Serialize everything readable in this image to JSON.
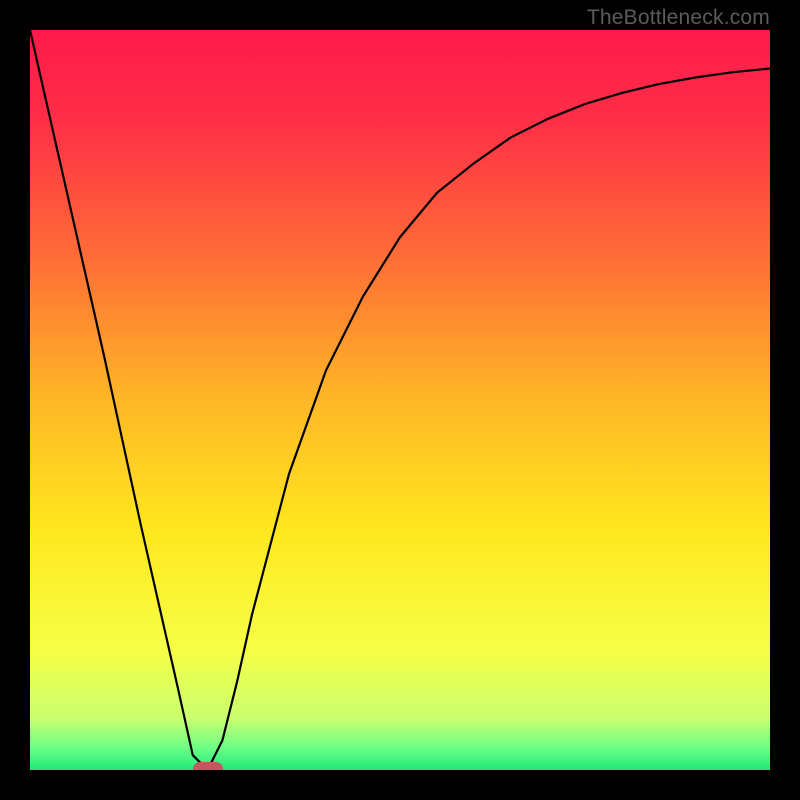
{
  "watermark": "TheBottleneck.com",
  "colors": {
    "background": "#000000",
    "gradient_stops": [
      {
        "pct": 0,
        "color": "#ff1a4b"
      },
      {
        "pct": 12,
        "color": "#ff2e47"
      },
      {
        "pct": 30,
        "color": "#ff6a37"
      },
      {
        "pct": 50,
        "color": "#ffb726"
      },
      {
        "pct": 68,
        "color": "#ffe81f"
      },
      {
        "pct": 84,
        "color": "#f6ff47"
      },
      {
        "pct": 93,
        "color": "#c9ff6e"
      },
      {
        "pct": 97,
        "color": "#6dff86"
      },
      {
        "pct": 100,
        "color": "#20e87a"
      }
    ],
    "curve": "#000000",
    "marker_fill": "#c15a5f",
    "marker_stroke": "#c15a5f"
  },
  "chart_data": {
    "type": "line",
    "title": "",
    "xlabel": "",
    "ylabel": "",
    "xlim": [
      0,
      100
    ],
    "ylim": [
      0,
      100
    ],
    "grid": false,
    "legend": false,
    "series": [
      {
        "name": "bottleneck-curve",
        "x": [
          0,
          5,
          10,
          15,
          20,
          22,
          24,
          26,
          28,
          30,
          35,
          40,
          45,
          50,
          55,
          60,
          65,
          70,
          75,
          80,
          85,
          90,
          95,
          100
        ],
        "y": [
          100,
          78,
          56,
          33,
          11,
          2,
          0,
          4,
          12,
          21,
          40,
          54,
          64,
          72,
          78,
          82,
          85.5,
          88,
          90,
          91.5,
          92.7,
          93.6,
          94.3,
          94.8
        ]
      }
    ],
    "annotations": [
      {
        "name": "optimal-point",
        "x": 24,
        "y": 0
      }
    ]
  }
}
